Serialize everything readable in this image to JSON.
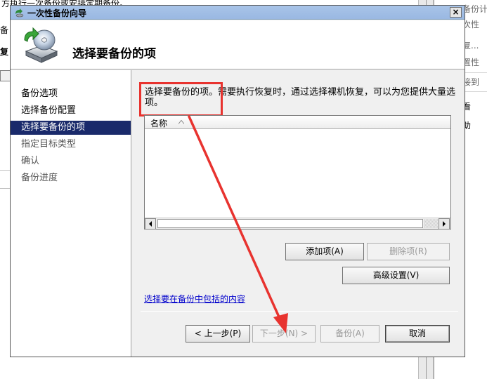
{
  "background": {
    "top_line": "方执行一次备份或安排定期备份。",
    "left_fragments": [
      "备",
      "复"
    ],
    "actions": [
      {
        "label": "备份计"
      },
      {
        "label": "次性"
      },
      {
        "label": "复..."
      },
      {
        "label": "置性"
      },
      {
        "label": "接到"
      },
      {
        "label": "看"
      },
      {
        "label": "助"
      }
    ]
  },
  "dialog": {
    "title": "一次性备份向导",
    "close_glyph": "×",
    "header_title": "选择要备份的项",
    "nav": [
      {
        "label": "备份选项",
        "state": "normal"
      },
      {
        "label": "选择备份配置",
        "state": "normal"
      },
      {
        "label": "选择要备份的项",
        "state": "active"
      },
      {
        "label": "指定目标类型",
        "state": "disabled"
      },
      {
        "label": "确认",
        "state": "disabled"
      },
      {
        "label": "备份进度",
        "state": "disabled"
      }
    ],
    "description": "选择要备份的项。需要执行恢复时，通过选择裸机恢复，可以为您提供大量选项。",
    "list": {
      "column_name": "名称"
    },
    "buttons": {
      "add_item": "添加项(A)",
      "remove_item": "删除项(R)",
      "advanced": "高级设置(V)"
    },
    "link": "选择要在备份中包括的内容",
    "footer": {
      "back": "< 上一步(P)",
      "next": "下一步(N) >",
      "backup": "备份(A)",
      "cancel": "取消"
    }
  },
  "colors": {
    "annotation_red": "#e8332f",
    "nav_active": "#1a2a6b",
    "link": "#0000cc"
  },
  "icons": {
    "title": "backup-wizard-icon",
    "header": "disk-backup-icon",
    "sort": "sort-ascending-icon",
    "scroll_left": "scroll-left-arrow-icon",
    "scroll_right": "scroll-right-arrow-icon",
    "close": "close-icon"
  }
}
